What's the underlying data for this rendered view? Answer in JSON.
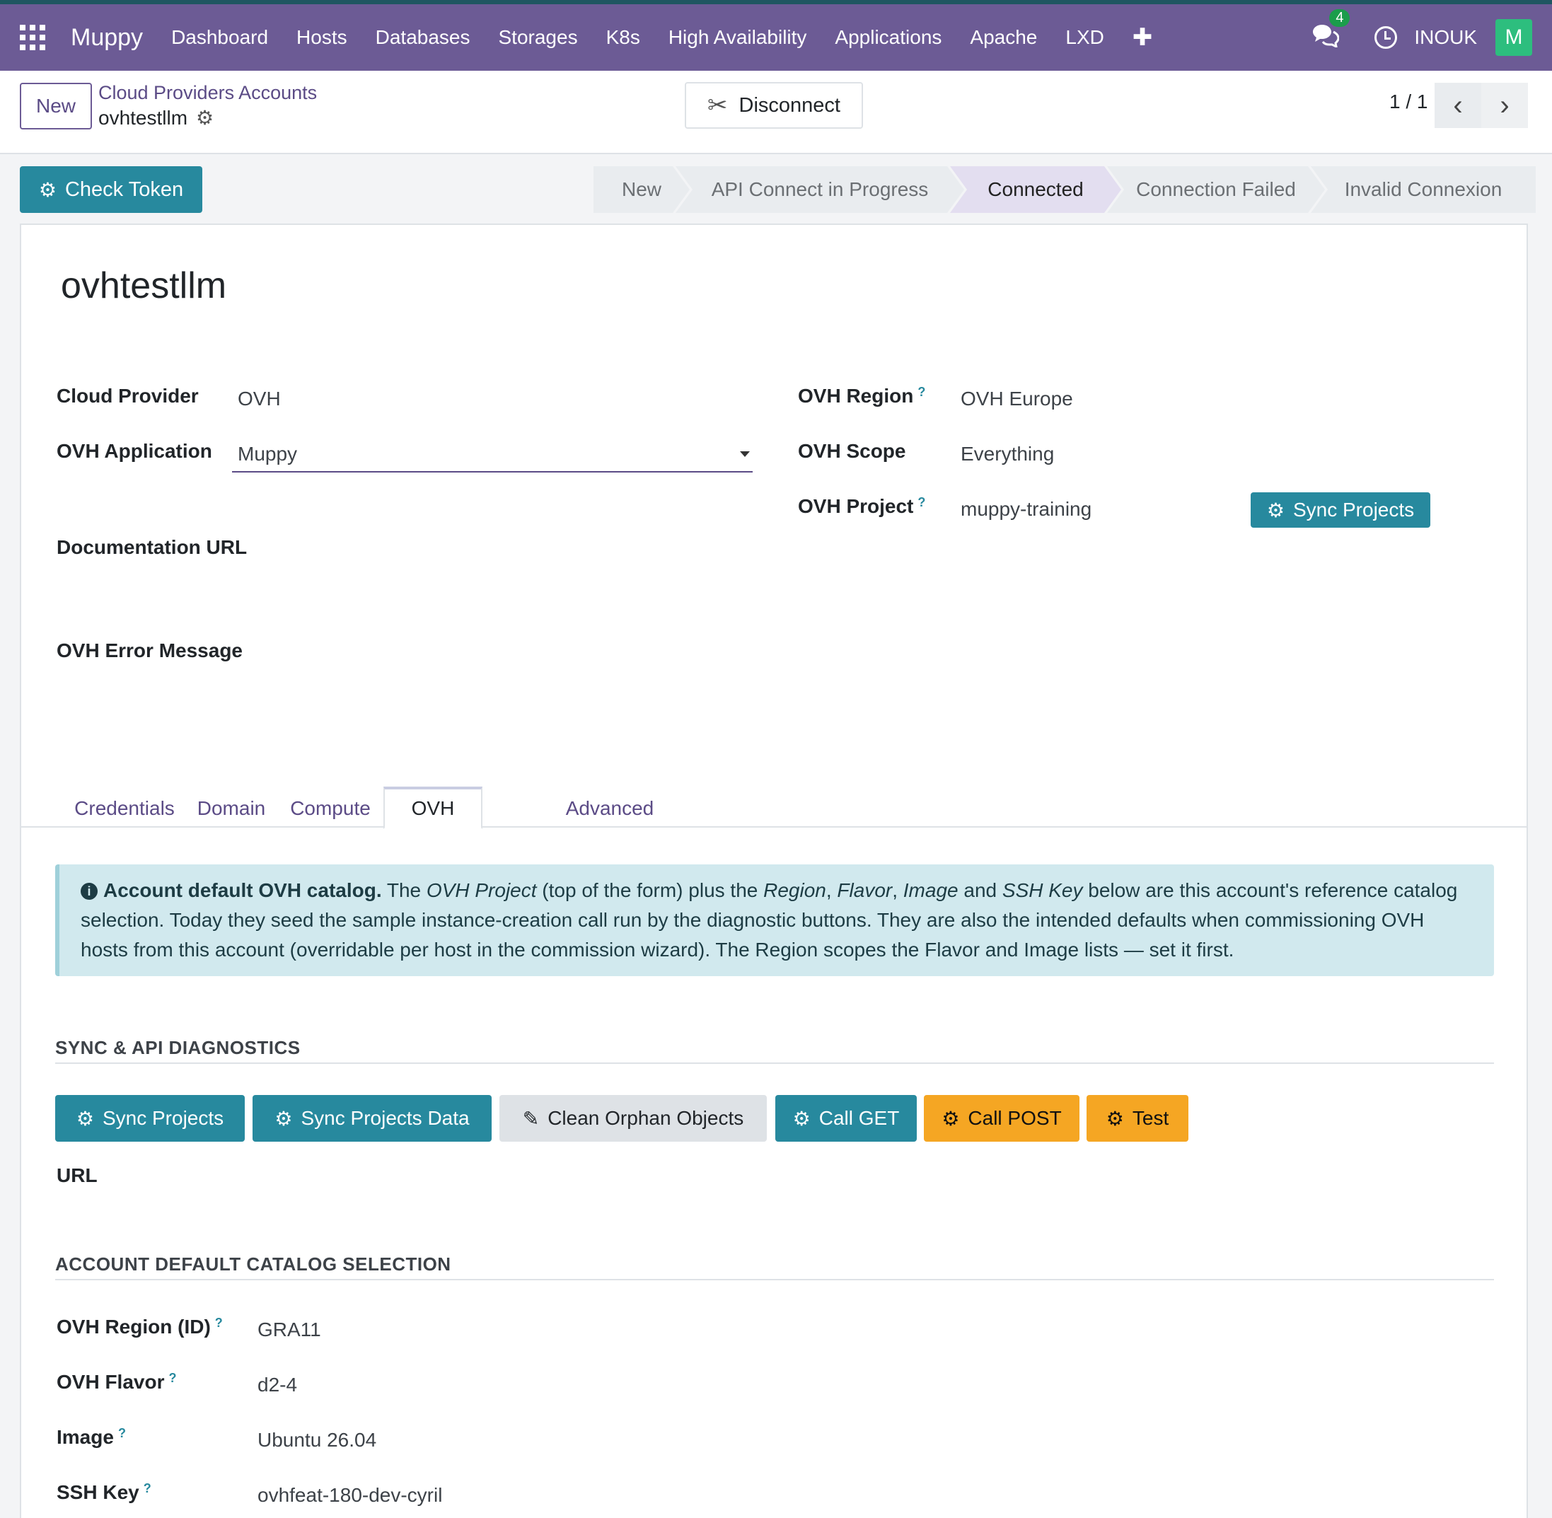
{
  "navbar": {
    "brand": "Muppy",
    "items": [
      "Dashboard",
      "Hosts",
      "Databases",
      "Storages",
      "K8s",
      "High Availability",
      "Applications",
      "Apache",
      "LXD"
    ],
    "plus": "✚",
    "chat_count": "4",
    "company": "INOUK",
    "avatar": "M"
  },
  "control": {
    "new_label": "New",
    "breadcrumb": "Cloud Providers Accounts",
    "record": "ovhtestllm",
    "disconnect_label": "Disconnect",
    "pager": "1 / 1"
  },
  "status": {
    "check_token_label": "Check Token",
    "stages": [
      "New",
      "API Connect in Progress",
      "Connected",
      "Connection Failed",
      "Invalid Connexion"
    ],
    "active_stage": "Connected"
  },
  "form": {
    "name": "ovhtestllm",
    "cloud_provider_label": "Cloud Provider",
    "cloud_provider": "OVH",
    "ovh_application_label": "OVH Application",
    "ovh_application": "Muppy",
    "documentation_url_label": "Documentation URL",
    "ovh_error_label": "OVH Error Message",
    "ovh_region_label": "OVH Region",
    "ovh_region": "OVH Europe",
    "ovh_scope_label": "OVH Scope",
    "ovh_scope": "Everything",
    "ovh_project_label": "OVH Project",
    "ovh_project": "muppy-training",
    "sync_projects_label": "Sync Projects",
    "help_mark": "?"
  },
  "tabs": [
    "Credentials",
    "Domain",
    "Compute",
    "OVH",
    "Advanced"
  ],
  "active_tab": "OVH",
  "alert": {
    "bold": "Account default OVH catalog.",
    "t1": " The ",
    "i1": "OVH Project",
    "t2": " (top of the form) plus the ",
    "i2": "Region",
    "t3": ", ",
    "i3": "Flavor",
    "t4": ", ",
    "i4": "Image",
    "t5": " and ",
    "i5": "SSH Key",
    "t6": " below are this account's reference catalog selection. Today they seed the sample instance-creation call run by the diagnostic buttons. They are also the intended defaults when commissioning OVH hosts from this account (overridable per host in the commission wizard). The Region scopes the Flavor and Image lists — set it first."
  },
  "diagnostics": {
    "title": "SYNC & API DIAGNOSTICS",
    "buttons": [
      "Sync Projects",
      "Sync Projects Data",
      "Clean Orphan Objects",
      "Call GET",
      "Call POST",
      "Test"
    ],
    "url_label": "URL"
  },
  "catalog": {
    "title": "ACCOUNT DEFAULT CATALOG SELECTION",
    "region_label": "OVH Region (ID)",
    "region": "GRA11",
    "flavor_label": "OVH Flavor",
    "flavor": "d2-4",
    "image_label": "Image",
    "image": "Ubuntu 26.04",
    "ssh_label": "SSH Key",
    "ssh": "ovhfeat-180-dev-cyril"
  },
  "colors": {
    "navbar": "#6c5b95",
    "teal_button": "#27899e",
    "orange_button": "#f5a623",
    "alert_bg": "#d1e9ee"
  }
}
